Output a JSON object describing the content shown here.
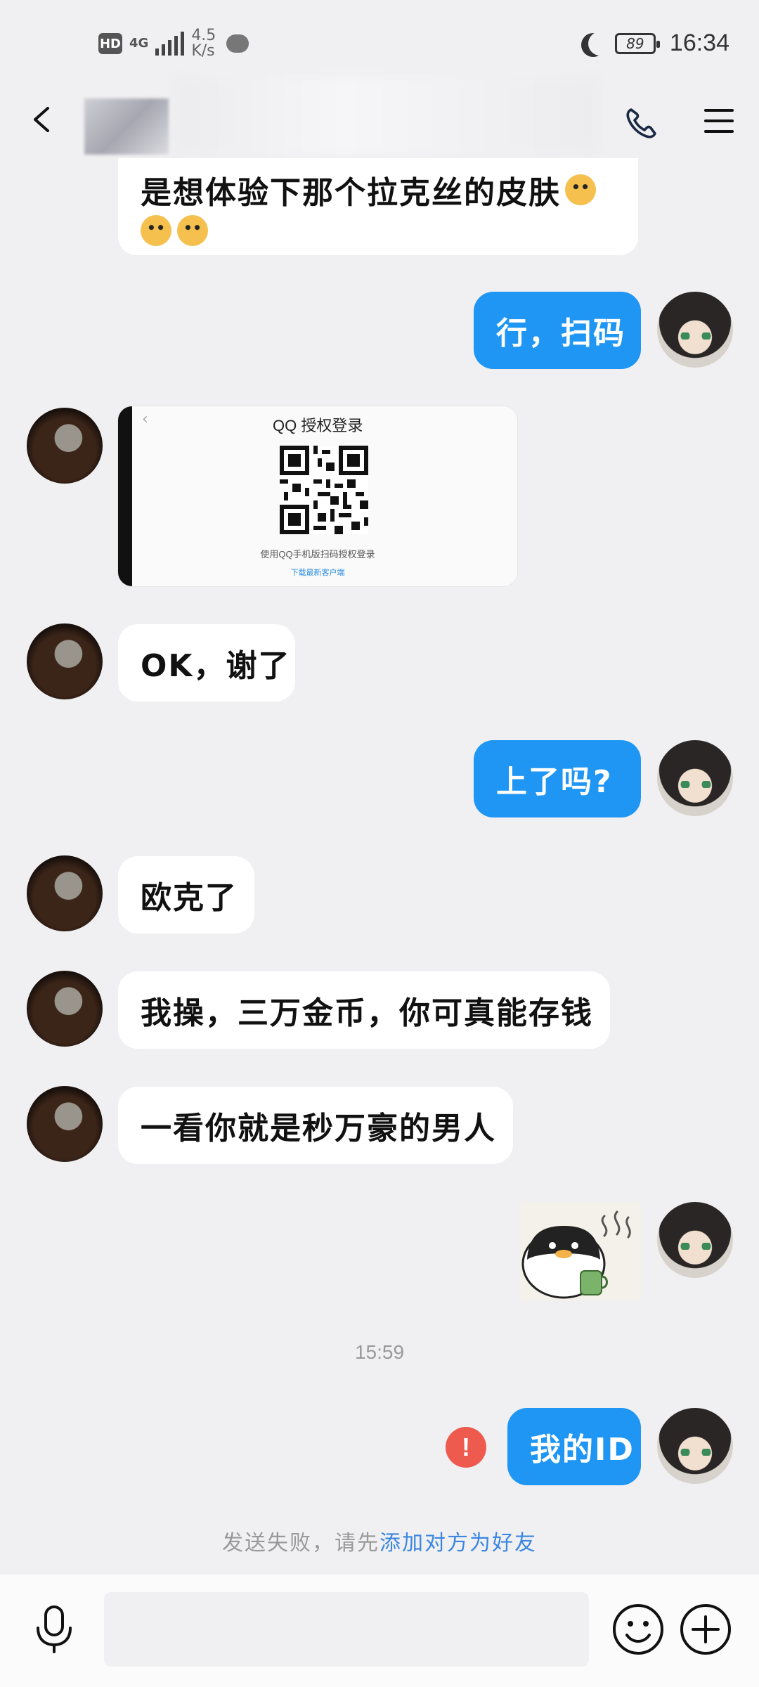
{
  "status_bar": {
    "hd": "HD",
    "network": "4G",
    "speed": "4.5 K/s",
    "battery": "89",
    "time": "16:34"
  },
  "messages": [
    {
      "id": "m1",
      "sender": "other",
      "text": "是想体验下那个拉克丝的皮肤"
    },
    {
      "id": "m2",
      "sender": "me",
      "text": "行，扫码"
    },
    {
      "id": "m3",
      "sender": "other",
      "type": "image"
    },
    {
      "id": "m4",
      "sender": "other",
      "text": "OK，谢了"
    },
    {
      "id": "m5",
      "sender": "me",
      "text": "上了吗?"
    },
    {
      "id": "m6",
      "sender": "other",
      "text": "欧克了"
    },
    {
      "id": "m7",
      "sender": "other",
      "text": "我操，三万金币，你可真能存钱"
    },
    {
      "id": "m8",
      "sender": "other",
      "text": "一看你就是秒万豪的男人"
    },
    {
      "id": "m9",
      "sender": "me",
      "type": "sticker"
    },
    {
      "id": "m10",
      "sender": "me",
      "text": "我的ID"
    }
  ],
  "qr_card": {
    "title": "QQ 授权登录",
    "caption": "使用QQ手机版扫码授权登录",
    "link": "下载最新客户端"
  },
  "timestamp": "15:59",
  "send_failed": {
    "text": "发送失败，请先",
    "link": "添加对方为好友",
    "icon": "!"
  },
  "colors": {
    "outgoing_bubble": "#1f96f3",
    "incoming_bubble": "#ffffff",
    "background": "#f0f0f2",
    "error": "#ee5a4e",
    "link": "#3a86e0"
  },
  "icons": [
    "back-icon",
    "phone-icon",
    "menu-icon",
    "mic-icon",
    "emoji-icon",
    "plus-icon",
    "error-icon"
  ]
}
